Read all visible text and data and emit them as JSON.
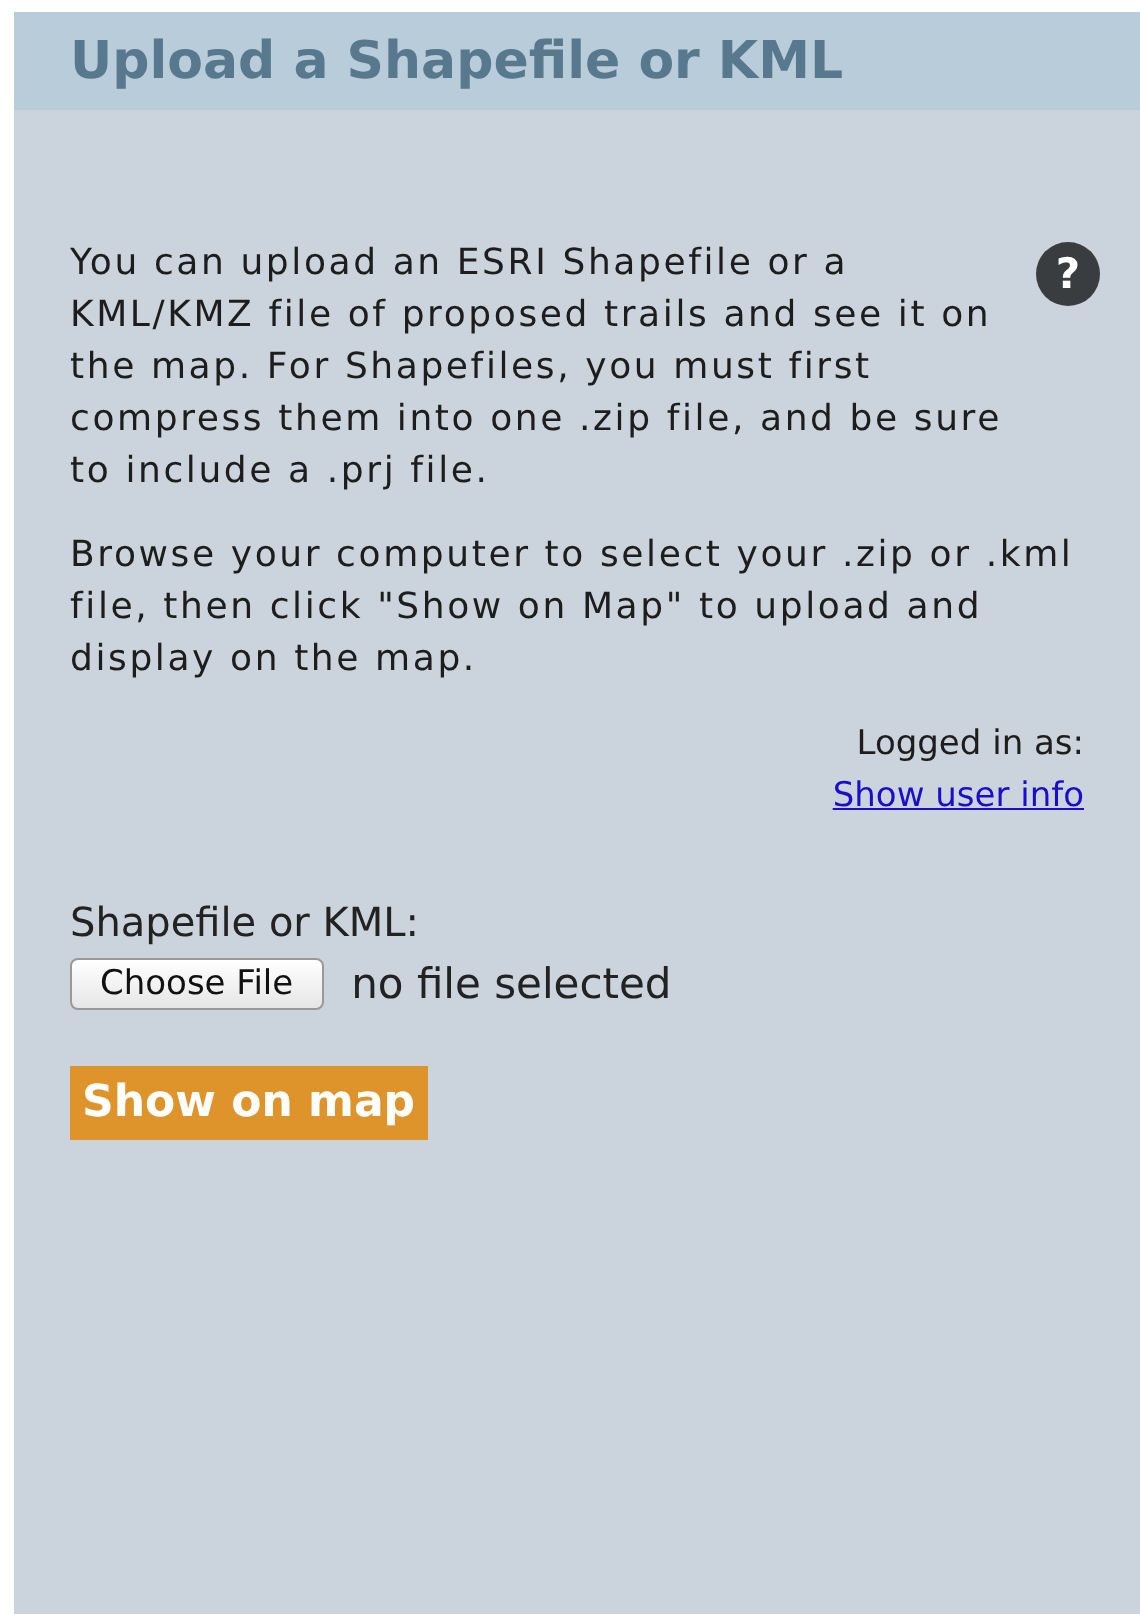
{
  "panel": {
    "title": "Upload a Shapefile or KML"
  },
  "help": {
    "label": "?"
  },
  "paragraphs": [
    "You can upload an ESRI Shapefile or a KML/KMZ file of proposed trails and see it on the map. For Shapefiles, you must first compress them into one .zip file, and be sure to include a .prj file.",
    "Browse your computer to select your .zip or .kml file, then click \"Show on Map\" to upload and display on the map."
  ],
  "login": {
    "label": "Logged in as:",
    "link": "Show user info"
  },
  "file_field": {
    "label": "Shapefile or KML:",
    "button": "Choose File",
    "status": "no file selected"
  },
  "submit": {
    "label": "Show on map"
  }
}
